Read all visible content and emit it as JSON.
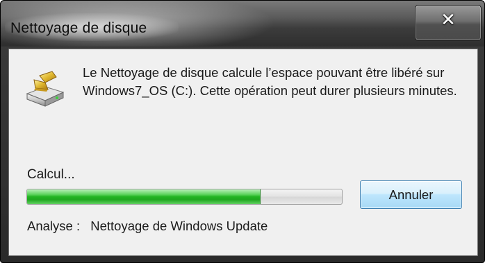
{
  "window": {
    "title": "Nettoyage de disque",
    "close_symbol": "✕"
  },
  "dialog": {
    "icon": "disk-cleanup-icon",
    "message": "Le Nettoyage de disque calcule l’espace pouvant être libéré sur Windows7_OS (C:). Cette opération peut durer plusieurs minutes.",
    "status_label": "Calcul...",
    "progress": {
      "fraction": 0.74
    },
    "cancel_label": "Annuler",
    "analysis_label": "Analyse :",
    "analysis_value": "Nettoyage de Windows Update"
  },
  "colors": {
    "progress_green": "#22b422",
    "button_border": "#3c7fb1",
    "title_text": "#0d0d0d"
  }
}
